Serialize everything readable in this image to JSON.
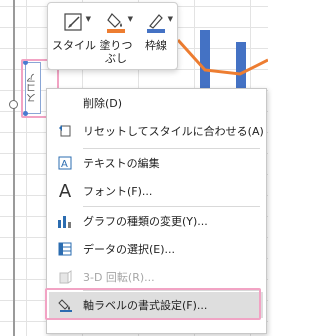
{
  "toolbar": {
    "style_label": "スタイル",
    "fill_label_line1": "塗りつ",
    "fill_label_line2": "ぶし",
    "outline_label": "枠線"
  },
  "axis_title": {
    "text": "スコア"
  },
  "context_menu": {
    "items": [
      {
        "label": "削除(D)",
        "icon": "delete-icon",
        "disabled": false
      },
      {
        "label": "リセットしてスタイルに合わせる(A)",
        "icon": "reset-style-icon",
        "disabled": false
      },
      {
        "label": "テキストの編集",
        "icon": "edit-text-icon",
        "disabled": false
      },
      {
        "label": "フォント(F)...",
        "icon": "font-icon",
        "disabled": false
      },
      {
        "label": "グラフの種類の変更(Y)...",
        "icon": "chart-type-icon",
        "disabled": false
      },
      {
        "label": "データの選択(E)...",
        "icon": "select-data-icon",
        "disabled": false
      },
      {
        "label": "3-D 回転(R)...",
        "icon": "3d-rotation-icon",
        "disabled": true
      },
      {
        "label": "軸ラベルの書式設定(F)...",
        "icon": "format-axis-label-icon",
        "disabled": false
      }
    ]
  },
  "colors": {
    "accent_pink": "#f2a3c4",
    "fill_orange": "#ed7d31",
    "outline_blue": "#4472c4",
    "bar_blue": "#4472c4"
  }
}
